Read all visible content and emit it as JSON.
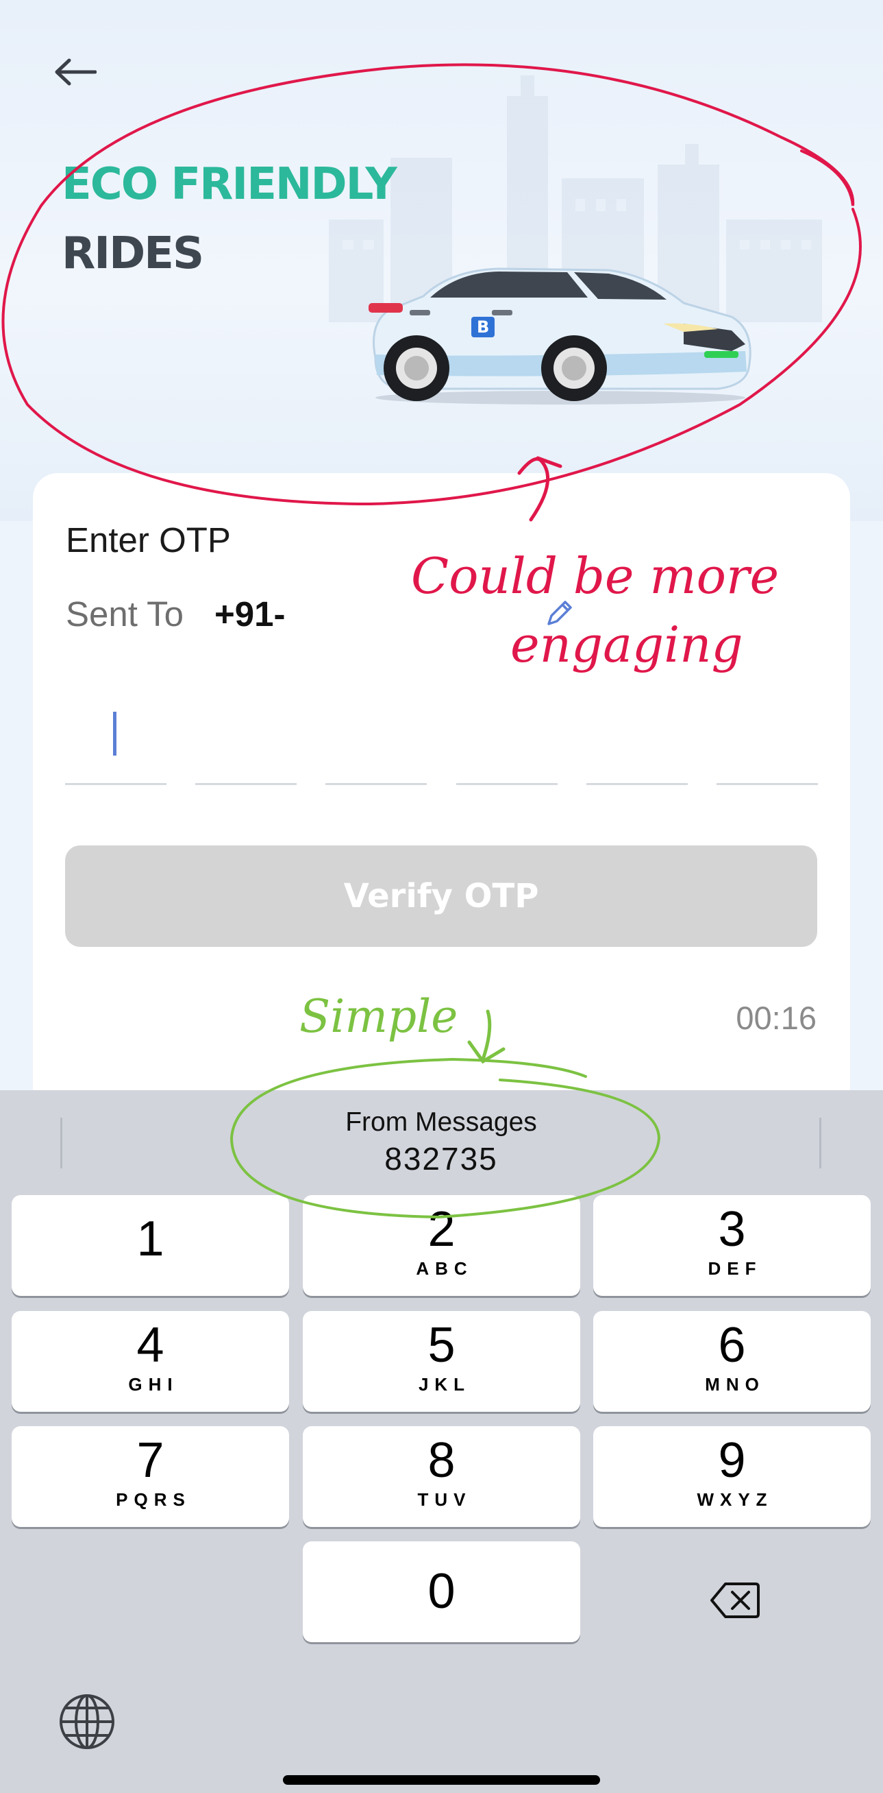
{
  "hero": {
    "title_line1": "ECO FRIENDLY",
    "title_line2": "RIDES",
    "back_icon": "arrow-left-icon",
    "car_logo_letter": "B"
  },
  "otp": {
    "title": "Enter OTP",
    "sent_to_label": "Sent To",
    "phone_prefix": "+91-",
    "edit_icon": "pencil-icon",
    "box_count": 6,
    "verify_label": "Verify OTP",
    "timer": "00:16"
  },
  "keyboard": {
    "suggestion_label": "From Messages",
    "suggestion_code": "832735",
    "keys": [
      {
        "num": "1",
        "letters": ""
      },
      {
        "num": "2",
        "letters": "ABC"
      },
      {
        "num": "3",
        "letters": "DEF"
      },
      {
        "num": "4",
        "letters": "GHI"
      },
      {
        "num": "5",
        "letters": "JKL"
      },
      {
        "num": "6",
        "letters": "MNO"
      },
      {
        "num": "7",
        "letters": "PQRS"
      },
      {
        "num": "8",
        "letters": "TUV"
      },
      {
        "num": "9",
        "letters": "WXYZ"
      },
      {
        "num": "0",
        "letters": ""
      }
    ],
    "delete_icon": "backspace-icon",
    "globe_icon": "globe-icon"
  },
  "annotations": {
    "red_note_line1": "Could be more",
    "red_note_line2": "engaging",
    "green_note": "Simple"
  },
  "colors": {
    "accent_green": "#2cb89b",
    "title_dark": "#3e4650",
    "annotation_red": "#e0174a",
    "annotation_green": "#7cc242",
    "caret_blue": "#5b7fd6"
  }
}
